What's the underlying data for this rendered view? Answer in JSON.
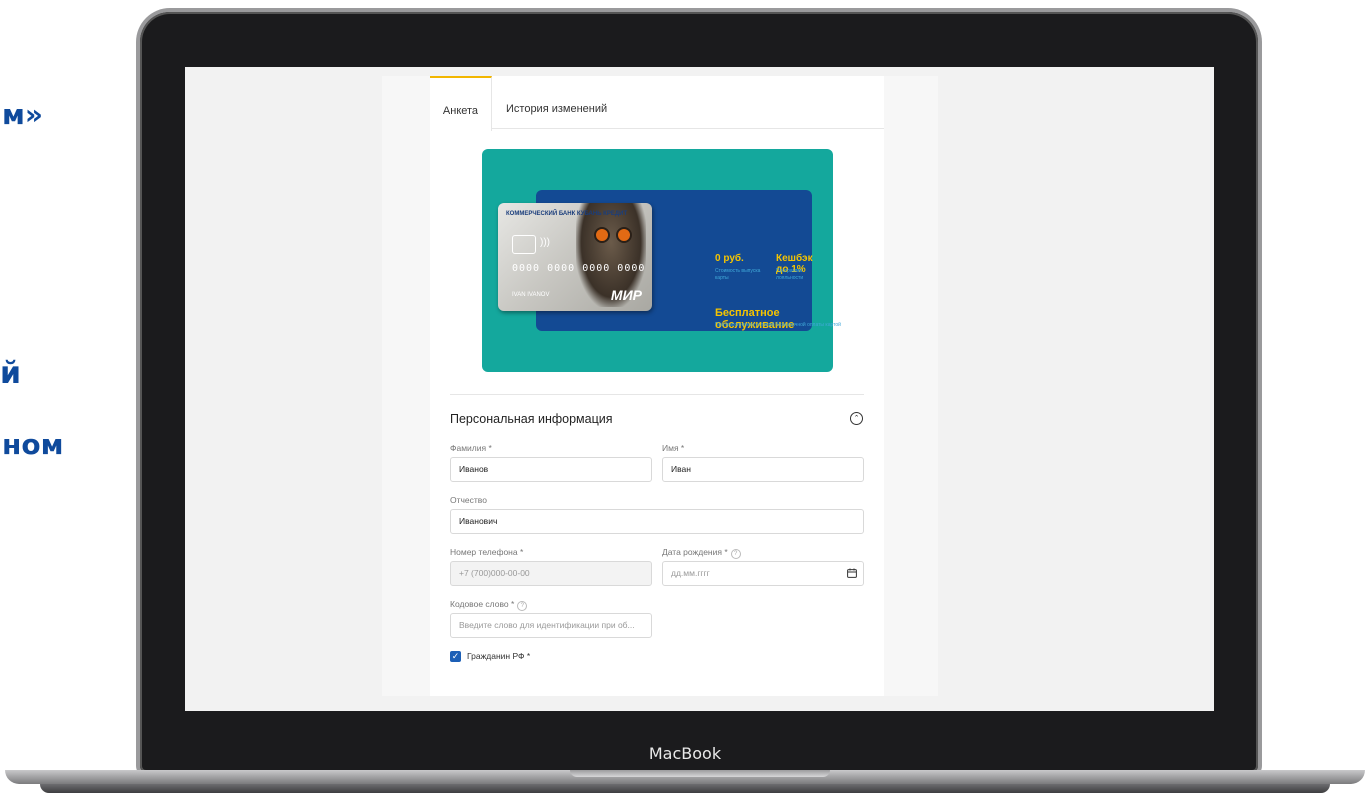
{
  "side_text": {
    "line1": "м»",
    "line2": "й",
    "line3": "ном"
  },
  "laptop": {
    "label": "MacBook"
  },
  "tabs": [
    {
      "label": "Анкета",
      "active": true
    },
    {
      "label": "История изменений",
      "active": false
    }
  ],
  "banner": {
    "card_bank": "КОММЕРЧЕСКИЙ БАНК КУБАНЬ КРЕДИТ",
    "card_number": "0000 0000 0000 0000",
    "card_name": "IVAN IVANOV",
    "card_brand": "МИР",
    "promo1_title": "0 руб.",
    "promo1_sub": "Стоимость выпуска карты",
    "promo2_title": "Кешбэк до 1%",
    "promo2_sub": "Программа лояльности",
    "promo3_title": "Бесплатное обслуживание",
    "promo3_sub": "При выполнении условий безналичной оплаты картой"
  },
  "section": {
    "title": "Персональная информация"
  },
  "form": {
    "last_name": {
      "label": "Фамилия *",
      "value": "Иванов"
    },
    "first_name": {
      "label": "Имя *",
      "value": "Иван"
    },
    "patronymic": {
      "label": "Отчество",
      "value": "Иванович"
    },
    "phone": {
      "label": "Номер телефона *",
      "placeholder": "+7 (700)000-00-00"
    },
    "birth_date": {
      "label": "Дата рождения *",
      "placeholder": "дд.мм.гггг"
    },
    "code_word": {
      "label": "Кодовое слово *",
      "placeholder": "Введите слово для идентификации при об..."
    },
    "citizen": {
      "label": "Гражданин РФ *",
      "checked": true
    }
  },
  "icons": {
    "help": "?",
    "collapse": "chevron-up-circle-icon",
    "calendar": "calendar-icon",
    "check": "✓"
  },
  "colors": {
    "accent_tab": "#f2b600",
    "banner_teal": "#14a89d",
    "banner_blue": "#134a94",
    "promo_yellow": "#f5c400",
    "checkbox_blue": "#1c5fb6",
    "heading_blue": "#0f4a9c"
  }
}
